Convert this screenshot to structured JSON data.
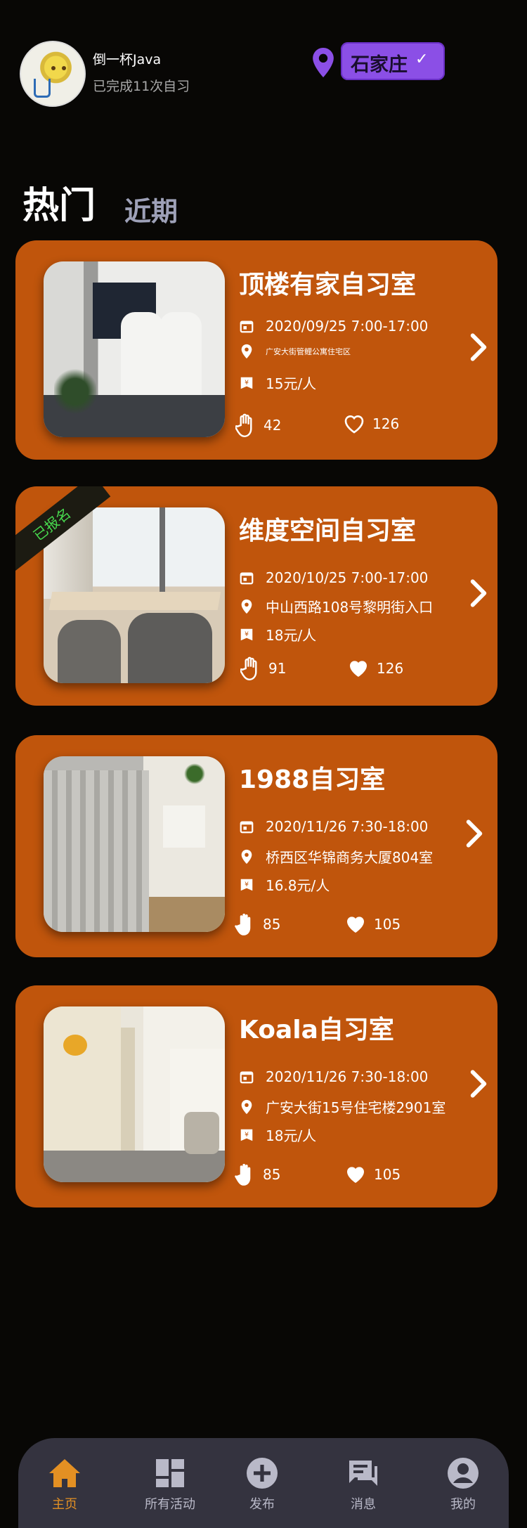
{
  "header": {
    "username": "倒一杯Java",
    "subtitle": "已完成11次自习",
    "city": "石家庄",
    "city_check": "✓"
  },
  "tabs": {
    "hot": "热门",
    "recent": "近期"
  },
  "cards": [
    {
      "title": "顶楼有家自习室",
      "datetime": "2020/09/25 7:00-17:00",
      "address": "广安大街管鲤公寓住宅区",
      "price": "15元/人",
      "hands": "42",
      "likes": "126",
      "badge": ""
    },
    {
      "title": "维度空间自习室",
      "datetime": "2020/10/25 7:00-17:00",
      "address": "中山西路108号黎明街入口",
      "price": "18元/人",
      "hands": "91",
      "likes": "126",
      "badge": "已报名"
    },
    {
      "title": "1988自习室",
      "datetime": "2020/11/26 7:30-18:00",
      "address": "桥西区华锦商务大厦804室",
      "price": "16.8元/人",
      "hands": "85",
      "likes": "105",
      "badge": ""
    },
    {
      "title": "Koala自习室",
      "datetime": "2020/11/26 7:30-18:00",
      "address": "广安大街15号住宅楼2901室",
      "price": "18元/人",
      "hands": "85",
      "likes": "105",
      "badge": ""
    }
  ],
  "nav": [
    {
      "label": "主页",
      "icon": "home-icon",
      "active": true
    },
    {
      "label": "所有活动",
      "icon": "dashboard-icon",
      "active": false
    },
    {
      "label": "发布",
      "icon": "plus-circle-icon",
      "active": false
    },
    {
      "label": "消息",
      "icon": "chat-icon",
      "active": false
    },
    {
      "label": "我的",
      "icon": "account-icon",
      "active": false
    }
  ],
  "colors": {
    "background": "#080705",
    "card": "#c0550c",
    "accent_purple": "#8b4fe6",
    "nav_bg": "#34333f",
    "nav_active": "#e39023",
    "ribbon_text": "#47d94e"
  }
}
